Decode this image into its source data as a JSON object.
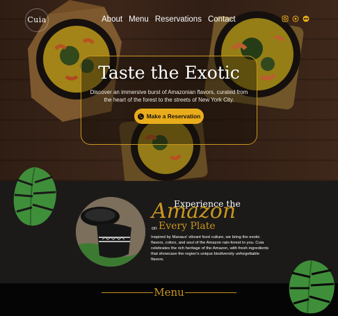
{
  "brand": {
    "logo_text": "Cuia"
  },
  "nav": {
    "items": [
      "About",
      "Menu",
      "Reservations",
      "Contact"
    ]
  },
  "socials": [
    "instagram-icon",
    "whatsapp-icon",
    "tripadvisor-icon"
  ],
  "hero": {
    "title": "Taste the Exotic",
    "subtitle": "Discover an immersive burst of Amazonian flavors, curated from the heart of the forest to the streets of New York City.",
    "cta_label": "Make a Reservation"
  },
  "about": {
    "heading_top": "Experience the",
    "heading_main": "Amazon",
    "heading_on": "on",
    "heading_bottom": "Every Plate",
    "description": "Inspired by Manaus' vibrant food culture, we bring the exotic flavors, colors, and soul of the Amazon rain-forest to you. Cuia celebrates the rich heritage of the Amazon, with fresh ingredients that showcase the region's unique biodiversity unforgettable flavors."
  },
  "menu_section": {
    "title": "Menu"
  },
  "colors": {
    "accent": "#c9961e",
    "cta": "#e9ad1c",
    "section_bg": "#1b1a19",
    "footer_bg": "#050505"
  }
}
